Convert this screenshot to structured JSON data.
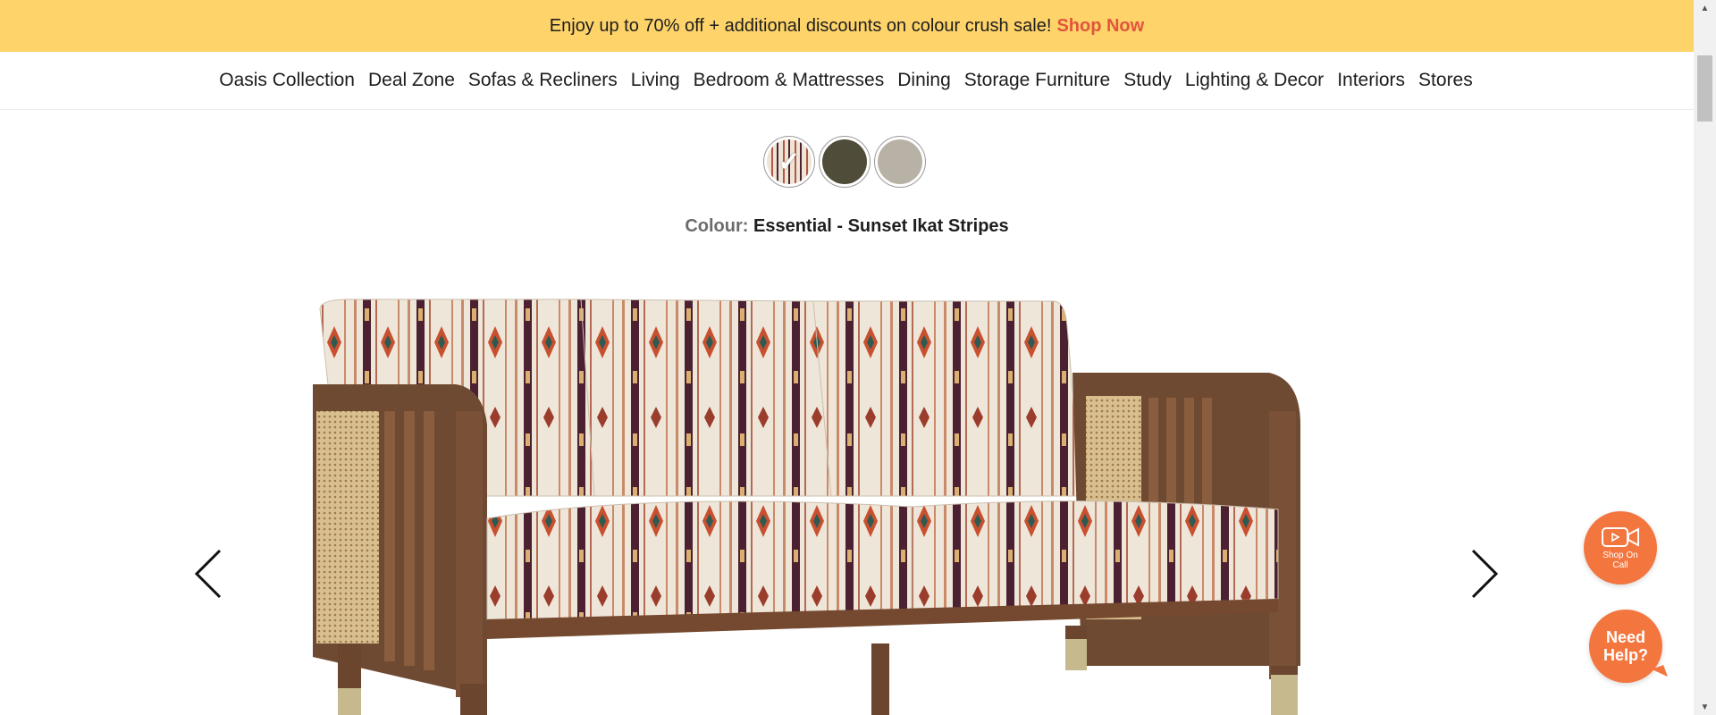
{
  "promo": {
    "text": "Enjoy up to 70% off + additional discounts on colour crush sale!",
    "link": "Shop Now"
  },
  "nav": {
    "items": [
      "Oasis Collection",
      "Deal Zone",
      "Sofas & Recliners",
      "Living",
      "Bedroom & Mattresses",
      "Dining",
      "Storage Furniture",
      "Study",
      "Lighting & Decor",
      "Interiors",
      "Stores"
    ]
  },
  "colour": {
    "label": "Colour:",
    "value": "Essential - Sunset Ikat Stripes",
    "swatches": [
      {
        "name": "Essential - Sunset Ikat Stripes",
        "color": "#efe4d6",
        "selected": true
      },
      {
        "name": "olive",
        "color": "#4f4c3a",
        "selected": false
      },
      {
        "name": "grey",
        "color": "#b8b2a6",
        "selected": false
      }
    ]
  },
  "floating": {
    "shop_on_call": "Shop On Call",
    "need_help": "Need Help?"
  },
  "colors": {
    "promo_bg": "#fdd36a",
    "accent": "#e2553c",
    "floating_bg": "#f4763f"
  },
  "icons": {
    "prev": "chevron-left-icon",
    "next": "chevron-right-icon",
    "video": "video-camera-icon",
    "check": "check-icon"
  }
}
